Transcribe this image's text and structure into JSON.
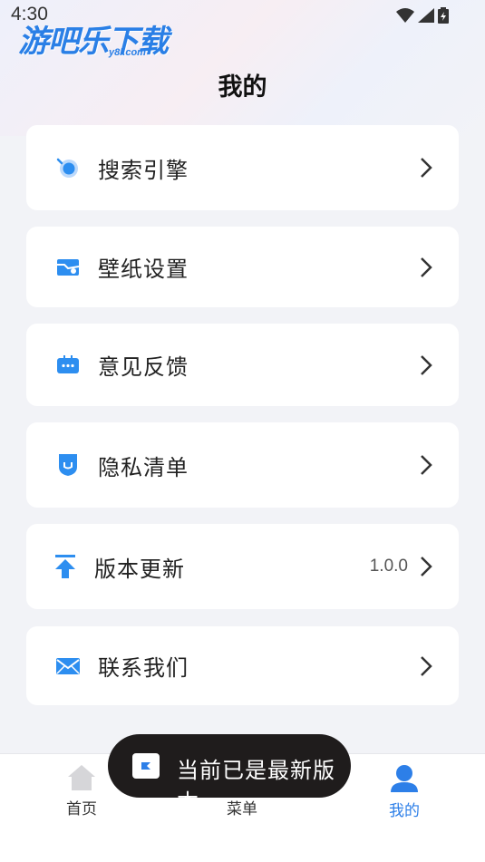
{
  "status_bar": {
    "time": "4:30"
  },
  "watermark": {
    "brand": "游吧乐下载",
    "domain": "y8l.com"
  },
  "header": {
    "title": "我的"
  },
  "menu": {
    "search_engine": {
      "label": "搜索引擎",
      "icon": "search-engine-icon"
    },
    "wallpaper": {
      "label": "壁纸设置",
      "icon": "wallpaper-icon"
    },
    "feedback": {
      "label": "意见反馈",
      "icon": "chat-icon"
    },
    "privacy": {
      "label": "隐私清单",
      "icon": "privacy-icon"
    },
    "update": {
      "label": "版本更新",
      "value": "1.0.0",
      "icon": "upload-icon"
    },
    "contact": {
      "label": "联系我们",
      "icon": "mail-icon"
    }
  },
  "toast": {
    "text": "当前已是最新版本"
  },
  "bottom_nav": {
    "home": {
      "label": "首页",
      "icon": "home-icon"
    },
    "menu": {
      "label": "菜单",
      "icon": "grid-icon"
    },
    "mine": {
      "label": "我的",
      "icon": "user-icon",
      "active": true
    }
  },
  "colors": {
    "accent": "#2d8ef0",
    "active_tab": "#2d7fe8",
    "background": "#f2f3f7",
    "toast_bg": "#1f1c1c"
  }
}
